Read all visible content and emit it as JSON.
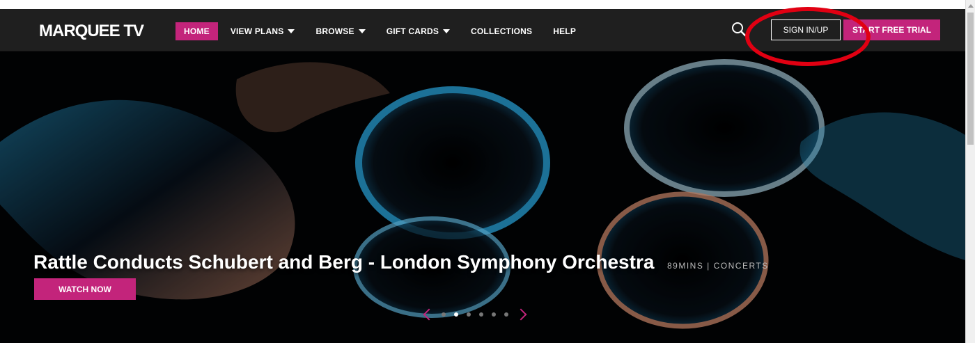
{
  "brand": {
    "logo_text": "MARQUEE TV"
  },
  "nav": {
    "items": [
      {
        "label": "HOME",
        "active": true,
        "dropdown": false
      },
      {
        "label": "VIEW PLANS",
        "active": false,
        "dropdown": true
      },
      {
        "label": "BROWSE",
        "active": false,
        "dropdown": true
      },
      {
        "label": "GIFT CARDS",
        "active": false,
        "dropdown": true
      },
      {
        "label": "COLLECTIONS",
        "active": false,
        "dropdown": false
      },
      {
        "label": "HELP",
        "active": false,
        "dropdown": false
      }
    ]
  },
  "header": {
    "search_icon": "search-icon",
    "signin_label": "SIGN IN/UP",
    "trial_label": "START FREE TRIAL"
  },
  "hero": {
    "title": "Rattle Conducts Schubert and Berg - London Symphony Orchestra",
    "meta": "89MINS | CONCERTS",
    "cta_label": "WATCH NOW"
  },
  "carousel": {
    "prev_icon": "chevron-left-icon",
    "next_icon": "chevron-right-icon",
    "active_index": 1,
    "dot_count": 6
  },
  "colors": {
    "accent": "#c3247b",
    "nav_bg": "#1f1f1f",
    "annotation": "#e10012"
  }
}
